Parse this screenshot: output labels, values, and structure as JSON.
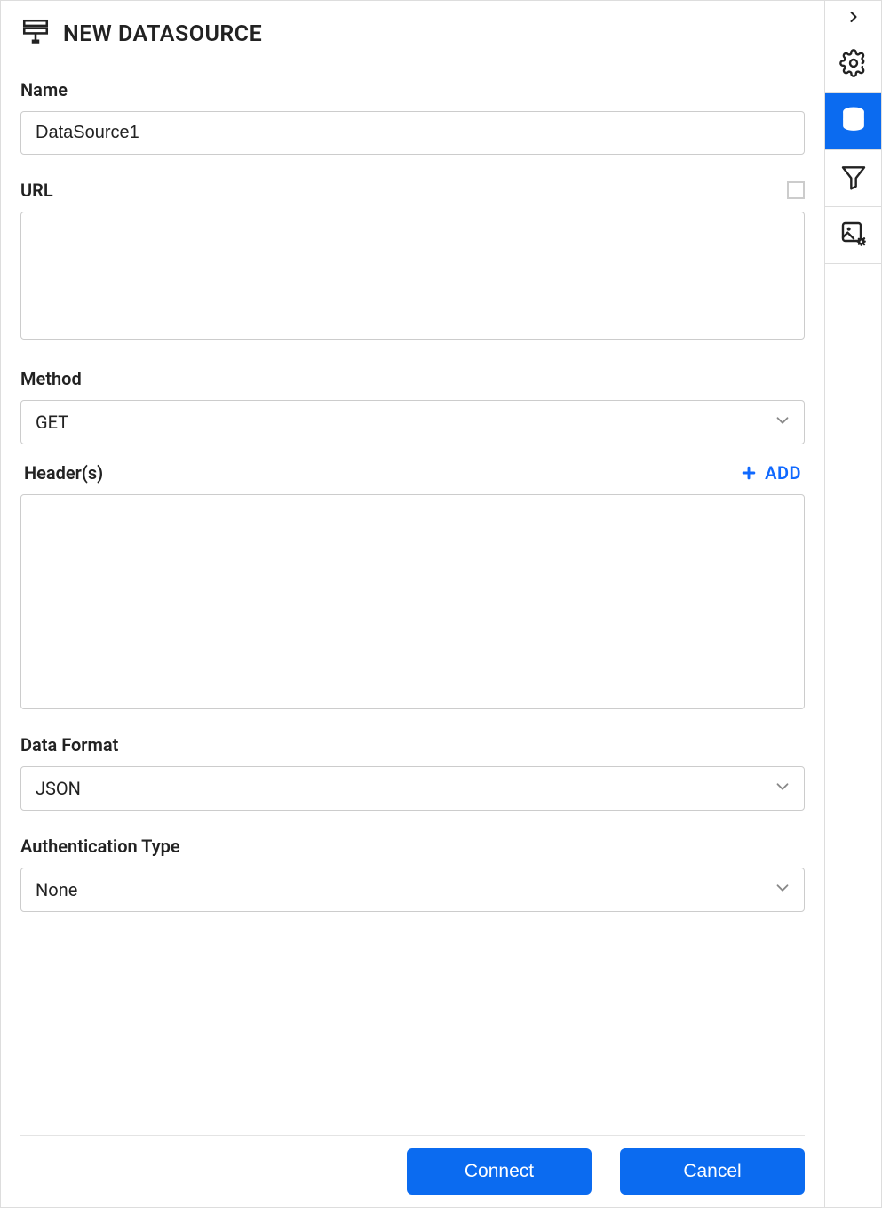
{
  "header": {
    "title": "NEW DATASOURCE"
  },
  "form": {
    "name": {
      "label": "Name",
      "value": "DataSource1"
    },
    "url": {
      "label": "URL",
      "value": ""
    },
    "method": {
      "label": "Method",
      "selected": "GET"
    },
    "headers": {
      "label": "Header(s)",
      "add_label": "ADD"
    },
    "dataFormat": {
      "label": "Data Format",
      "selected": "JSON"
    },
    "authType": {
      "label": "Authentication Type",
      "selected": "None"
    }
  },
  "footer": {
    "connect": "Connect",
    "cancel": "Cancel"
  },
  "sidebar": {
    "items": [
      {
        "name": "expand",
        "active": false
      },
      {
        "name": "settings",
        "active": false
      },
      {
        "name": "datasource",
        "active": true
      },
      {
        "name": "filter",
        "active": false
      },
      {
        "name": "image-settings",
        "active": false
      }
    ]
  }
}
